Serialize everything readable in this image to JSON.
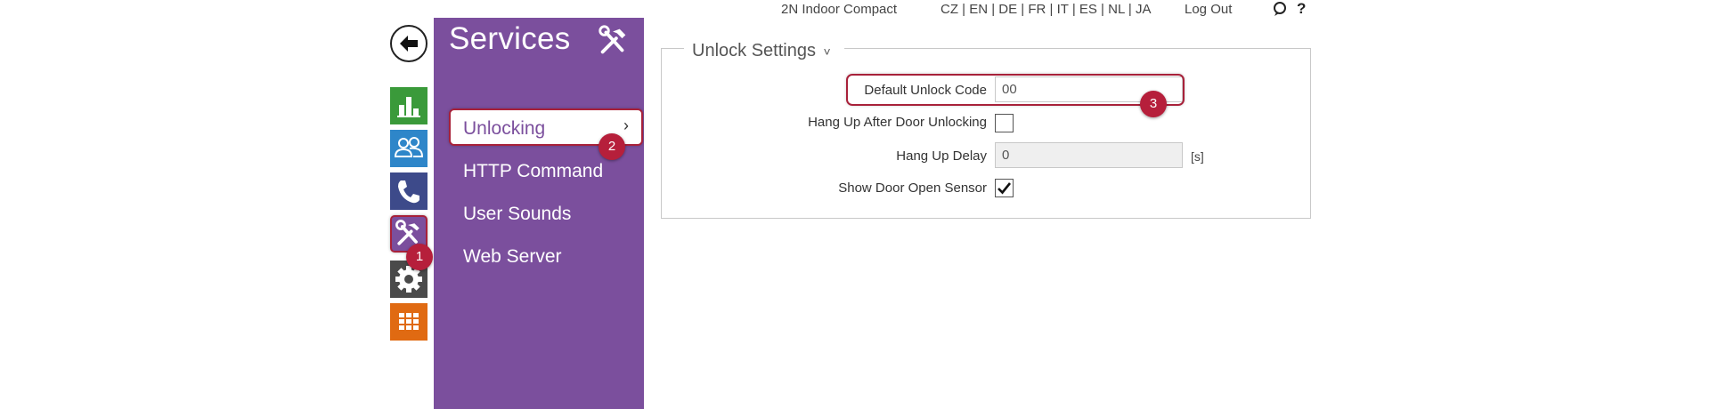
{
  "topbar": {
    "device_name": "2N Indoor Compact",
    "languages": "CZ | EN | DE | FR | IT | ES | NL | JA",
    "logout": "Log Out",
    "help": "?"
  },
  "sidebar_icons": {
    "back": "back-arrow-icon",
    "items": [
      {
        "name": "status",
        "icon": "bar-chart-icon",
        "color": "#3a9a3a"
      },
      {
        "name": "directory",
        "icon": "users-icon",
        "color": "#2e86c9"
      },
      {
        "name": "calls",
        "icon": "phone-icon",
        "color": "#3d4a8a"
      },
      {
        "name": "services",
        "icon": "tools-icon",
        "color": "#7b4f9d"
      },
      {
        "name": "system",
        "icon": "gear-icon",
        "color": "#4a4a4a"
      },
      {
        "name": "hardware",
        "icon": "grid-icon",
        "color": "#e06a12"
      }
    ]
  },
  "services": {
    "title": "Services",
    "icon": "tools-icon",
    "items": [
      {
        "label": "Unlocking"
      },
      {
        "label": "HTTP Command"
      },
      {
        "label": "User Sounds"
      },
      {
        "label": "Web Server"
      }
    ]
  },
  "badges": [
    "1",
    "2",
    "3"
  ],
  "unlock_settings": {
    "title": "Unlock Settings",
    "fields": {
      "default_unlock_code": {
        "label": "Default Unlock Code",
        "value": "00"
      },
      "hang_up_after_unlocking": {
        "label": "Hang Up After Door Unlocking",
        "checked": false
      },
      "hang_up_delay": {
        "label": "Hang Up Delay",
        "value": "0",
        "unit": "[s]"
      },
      "show_door_open_sensor": {
        "label": "Show Door Open Sensor",
        "checked": true
      }
    }
  }
}
